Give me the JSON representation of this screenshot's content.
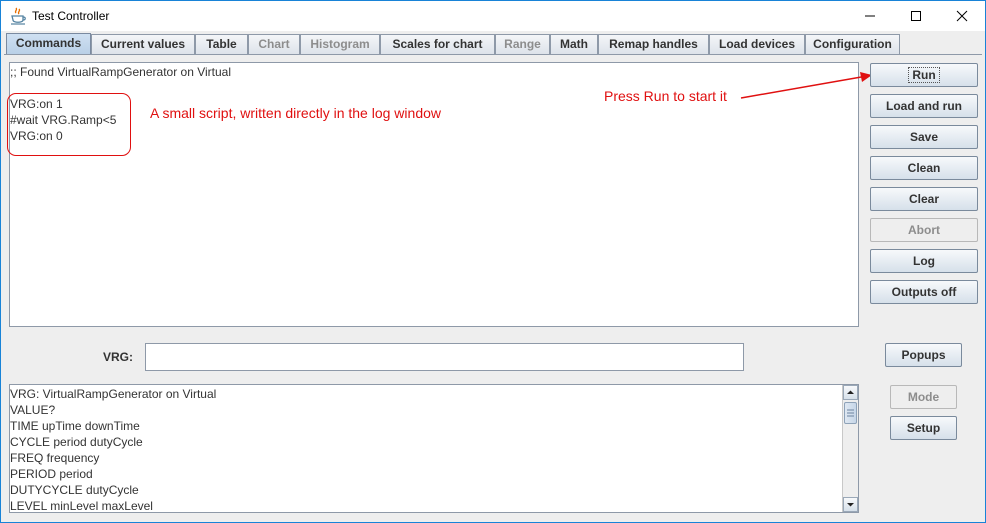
{
  "window": {
    "title": "Test Controller",
    "minimize_icon": "minimize-icon",
    "maximize_icon": "maximize-icon",
    "close_icon": "close-icon"
  },
  "tabs": [
    {
      "label": "Commands",
      "state": "active"
    },
    {
      "label": "Current values",
      "state": "enabled"
    },
    {
      "label": "Table",
      "state": "enabled"
    },
    {
      "label": "Chart",
      "state": "disabled"
    },
    {
      "label": "Histogram",
      "state": "disabled"
    },
    {
      "label": "Scales for chart",
      "state": "enabled"
    },
    {
      "label": "Range",
      "state": "disabled"
    },
    {
      "label": "Math",
      "state": "enabled"
    },
    {
      "label": "Remap handles",
      "state": "enabled"
    },
    {
      "label": "Load devices",
      "state": "enabled"
    },
    {
      "label": "Configuration",
      "state": "enabled"
    }
  ],
  "log": {
    "lines": [
      ";; Found VirtualRampGenerator on Virtual",
      "",
      "VRG:on 1",
      "#wait VRG.Ramp<5",
      "VRG:on 0"
    ]
  },
  "annotations": {
    "script_note": "A small script, written directly in the log window",
    "run_note": "Press Run to start it",
    "color": "#e01010"
  },
  "buttons": {
    "run": "Run",
    "load_and_run": "Load and run",
    "save": "Save",
    "clean": "Clean",
    "clear": "Clear",
    "abort": "Abort",
    "log": "Log",
    "outputs_off": "Outputs off",
    "popups": "Popups",
    "mode": "Mode",
    "setup": "Setup"
  },
  "device": {
    "label": "VRG:",
    "value": ""
  },
  "help_list": [
    "VRG: VirtualRampGenerator on Virtual",
    "VALUE?",
    "TIME upTime downTime",
    "CYCLE period dutyCycle",
    "FREQ frequency",
    "PERIOD period",
    "DUTYCYCLE dutyCycle",
    "LEVEL minLevel maxLevel"
  ]
}
